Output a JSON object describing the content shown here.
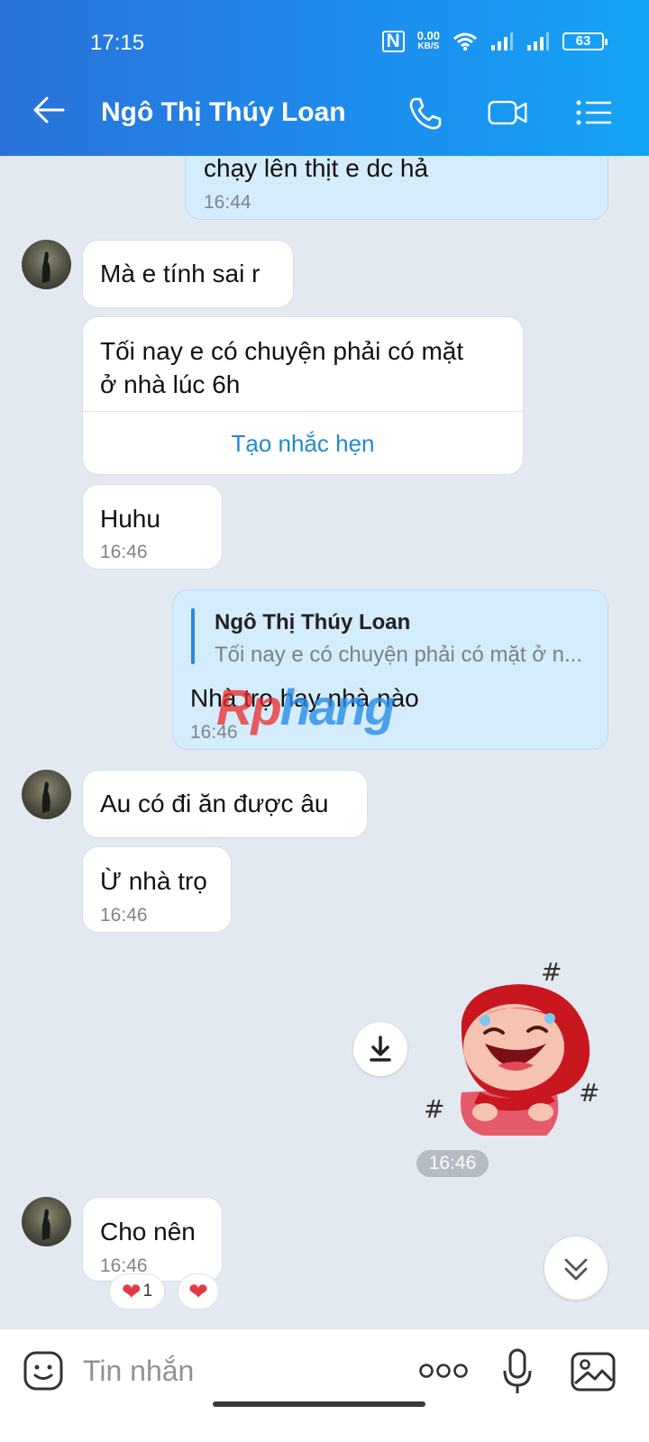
{
  "status_bar": {
    "time": "17:15",
    "network_speed_value": "0.00",
    "network_speed_unit": "KB/S",
    "battery": "63"
  },
  "header": {
    "contact_name": "Ngô Thị Thúy Loan",
    "back_icon": "arrow-left-icon",
    "call_icon": "phone-icon",
    "video_icon": "video-camera-icon",
    "menu_icon": "list-menu-icon"
  },
  "messages": [
    {
      "id": "m0",
      "sender": "me",
      "text": "chạy lên thịt e dc hả",
      "time": "16:44"
    },
    {
      "id": "m1",
      "sender": "contact",
      "text": "Mà e tính sai r"
    },
    {
      "id": "m2",
      "sender": "contact",
      "text_line1": "Tối nay e có chuyện phải có mặt",
      "text_line2": "ở nhà lúc 6h",
      "action": "Tạo nhắc hẹn"
    },
    {
      "id": "m3",
      "sender": "contact",
      "text": "Huhu",
      "time": "16:46"
    },
    {
      "id": "m4",
      "sender": "me",
      "quote_name": "Ngô Thị Thúy Loan",
      "quote_text": "Tối nay e có chuyện phải có mặt ở n...",
      "text": "Nhà trọ hay nhà nào",
      "time": "16:46"
    },
    {
      "id": "m5",
      "sender": "contact",
      "text": "Au có đi ăn được âu"
    },
    {
      "id": "m6",
      "sender": "contact",
      "text": "Ừ nhà trọ",
      "time": "16:46"
    },
    {
      "id": "m7",
      "sender": "me",
      "type": "sticker",
      "time": "16:46"
    },
    {
      "id": "m8",
      "sender": "contact",
      "text": "Cho nên",
      "time": "16:46",
      "reaction_count": "1"
    }
  ],
  "watermark": {
    "part1": "Rp",
    "part2": "hang"
  },
  "composer": {
    "placeholder": "Tin nhắn",
    "emoji_icon": "emoji-icon",
    "more_icon": "more-dots-icon",
    "mic_icon": "microphone-icon",
    "image_icon": "image-icon"
  },
  "colors": {
    "header": "#1d8cee",
    "my_bubble": "#d4ecfc",
    "background": "#e2e9f1",
    "link": "#1f8ad4"
  }
}
